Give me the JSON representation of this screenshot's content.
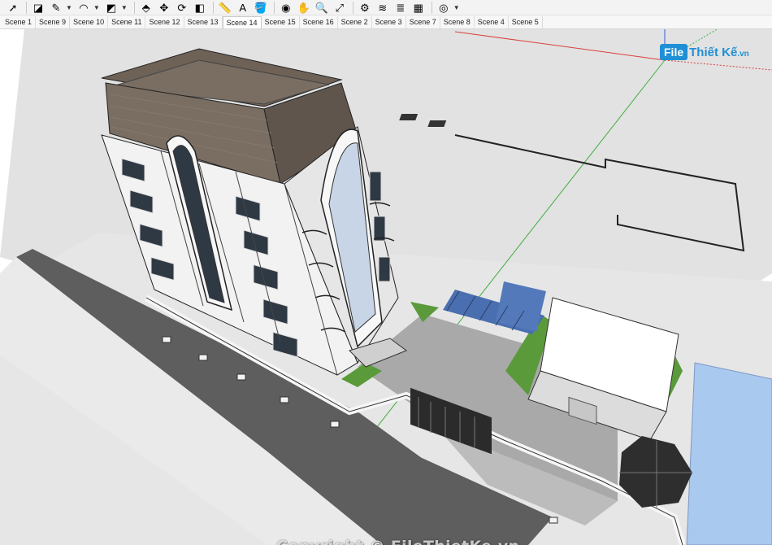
{
  "toolbar": {
    "tools": [
      {
        "name": "select-tool-icon",
        "glyph": "➚"
      },
      {
        "name": "eraser-tool-icon",
        "glyph": "◪"
      },
      {
        "name": "pencil-tool-icon",
        "glyph": "✎",
        "caret": true
      },
      {
        "name": "arc-tool-icon",
        "glyph": "◠",
        "caret": true
      },
      {
        "name": "shape-tool-icon",
        "glyph": "◩",
        "caret": true
      },
      {
        "name": "push-pull-tool-icon",
        "glyph": "⬘"
      },
      {
        "name": "move-tool-icon",
        "glyph": "✥"
      },
      {
        "name": "rotate-tool-icon",
        "glyph": "⟳"
      },
      {
        "name": "scale-tool-icon",
        "glyph": "◧"
      },
      {
        "name": "tape-measure-tool-icon",
        "glyph": "📏"
      },
      {
        "name": "text-tool-icon",
        "glyph": "A"
      },
      {
        "name": "paint-bucket-tool-icon",
        "glyph": "🪣"
      },
      {
        "name": "orbit-tool-icon",
        "glyph": "◉"
      },
      {
        "name": "pan-tool-icon",
        "glyph": "✋"
      },
      {
        "name": "zoom-tool-icon",
        "glyph": "🔍"
      },
      {
        "name": "zoom-extents-tool-icon",
        "glyph": "⤢"
      },
      {
        "name": "warehouse-icon",
        "glyph": "⚙"
      },
      {
        "name": "extension-icon",
        "glyph": "≋"
      },
      {
        "name": "layers-icon",
        "glyph": "≣"
      },
      {
        "name": "components-icon",
        "glyph": "▦"
      },
      {
        "name": "account-icon",
        "glyph": "◎",
        "caret": true
      }
    ]
  },
  "scenes": [
    "Scene 1",
    "Scene 9",
    "Scene 10",
    "Scene 11",
    "Scene 12",
    "Scene 13",
    "Scene 14",
    "Scene 15",
    "Scene 16",
    "Scene 2",
    "Scene 3",
    "Scene 7",
    "Scene 8",
    "Scene 4",
    "Scene 5"
  ],
  "active_scene": "Scene 14",
  "logo": {
    "badge": "File",
    "name": "Thiết Kế",
    "tld": ".vn"
  },
  "watermark": "Copyright © FileThietKe.vn",
  "colors": {
    "roof": "#6e6257",
    "grass": "#5a9a3a",
    "pool": "#aac9ef",
    "canopy": "#4a6fb0",
    "road": "#5a5a5a"
  }
}
